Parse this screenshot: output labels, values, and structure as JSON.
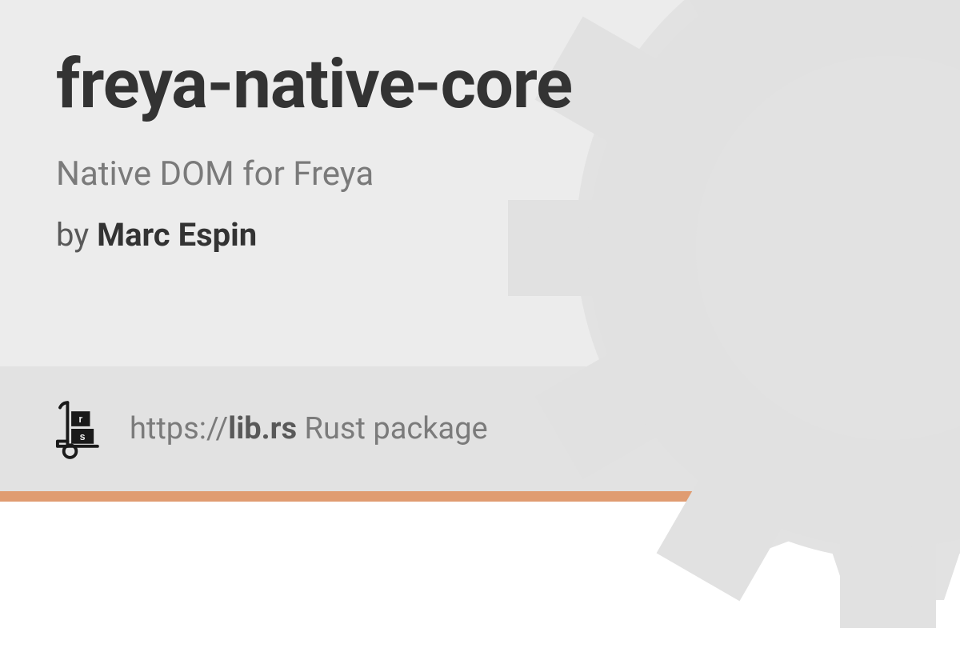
{
  "package": {
    "name": "freya-native-core",
    "description": "Native DOM for Freya"
  },
  "byline": {
    "prefix": "by ",
    "author": "Marc Espin"
  },
  "footer": {
    "url_prefix": "https://",
    "domain": "lib.rs",
    "suffix": " Rust package"
  },
  "colors": {
    "accent": "#e09c71",
    "main_bg": "#ececec",
    "footer_bg": "#e2e2e2"
  }
}
